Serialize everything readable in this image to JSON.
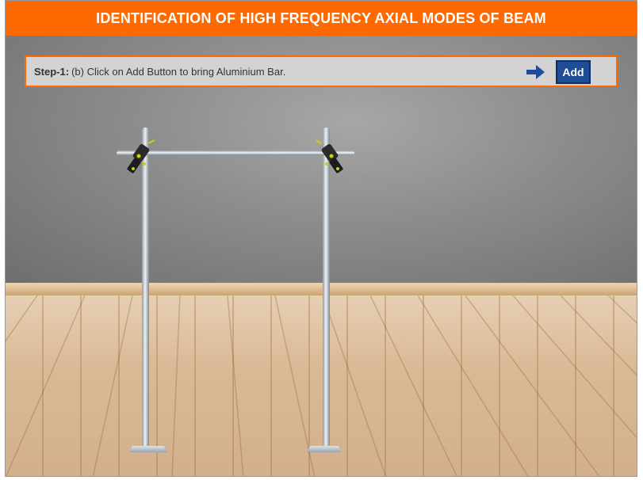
{
  "header": {
    "title": "IDENTIFICATION OF HIGH FREQUENCY AXIAL MODES OF BEAM"
  },
  "instruction": {
    "step_label": "Step-1:",
    "step_text": "(b) Click on Add Button to bring Aluminium Bar.",
    "arrow_icon": "right-arrow-icon",
    "add_button_label": "Add"
  },
  "colors": {
    "header_bg": "#ff6a00",
    "step_border": "#ff6a00",
    "add_button_bg": "#1f4c97",
    "arrow": "#1f4c97"
  },
  "scene": {
    "background": "grey wall with wooden plank floor",
    "apparatus": "two vertical stands with horizontal cross rod and clamps"
  }
}
